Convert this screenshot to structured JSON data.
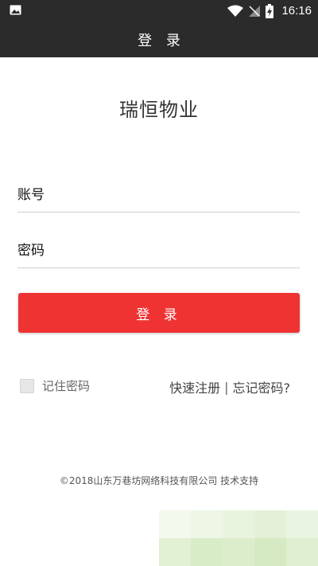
{
  "status_bar": {
    "time": "16:16",
    "icons": [
      "image-icon",
      "wifi-icon",
      "no-signal-icon",
      "battery-charging-icon"
    ]
  },
  "app_bar": {
    "title": "登 录"
  },
  "app_name": "瑞恒物业",
  "form": {
    "account_placeholder": "账号",
    "account_value": "",
    "password_placeholder": "密码",
    "password_value": ""
  },
  "login_button_label": "登 录",
  "remember_password": {
    "label": "记住密码",
    "checked": false
  },
  "links": {
    "register": "快速注册",
    "separator": "|",
    "forgot": "忘记密码?"
  },
  "footer": "©2018山东万巷坊网络科技有限公司 技术支持",
  "colors": {
    "bar": "#2b2b2b",
    "accent": "#ef3333",
    "background": "#ffffff"
  }
}
